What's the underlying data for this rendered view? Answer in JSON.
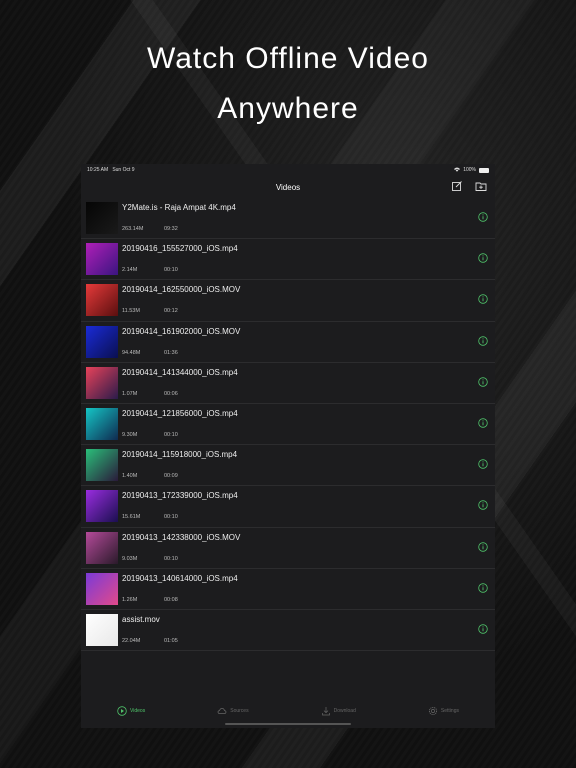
{
  "headline": {
    "line1": "Watch Offline Video",
    "line2": "Anywhere"
  },
  "status": {
    "time": "10:25 AM",
    "date": "Sun Oct 9",
    "battery": "100%"
  },
  "nav": {
    "title": "Videos",
    "edit_icon": "edit-icon",
    "add_icon": "add-folder-icon"
  },
  "videos": [
    {
      "name": "Y2Mate.is - Raja Ampat 4K.mp4",
      "size": "263.14M",
      "duration": "09:32",
      "thumb": [
        "#050505",
        "#1a1a1a"
      ]
    },
    {
      "name": "20190416_155527000_iOS.mp4",
      "size": "2.14M",
      "duration": "00:10",
      "thumb": [
        "#b01fb8",
        "#3a1580"
      ]
    },
    {
      "name": "20190414_162550000_iOS.MOV",
      "size": "11.53M",
      "duration": "00:12",
      "thumb": [
        "#e63a3a",
        "#5a0f0f"
      ]
    },
    {
      "name": "20190414_161902000_iOS.MOV",
      "size": "94.48M",
      "duration": "01:36",
      "thumb": [
        "#1a2bd8",
        "#0a0f50"
      ]
    },
    {
      "name": "20190414_141344000_iOS.mp4",
      "size": "1.07M",
      "duration": "00:06",
      "thumb": [
        "#e8425a",
        "#2a1b4a"
      ]
    },
    {
      "name": "20190414_121856000_iOS.mp4",
      "size": "9.30M",
      "duration": "00:10",
      "thumb": [
        "#15c6c6",
        "#0f2a50"
      ]
    },
    {
      "name": "20190414_115918000_iOS.mp4",
      "size": "1.40M",
      "duration": "00:09",
      "thumb": [
        "#2abf7a",
        "#2a1a3a"
      ]
    },
    {
      "name": "20190413_172339000_iOS.mp4",
      "size": "15.61M",
      "duration": "00:10",
      "thumb": [
        "#9a2de0",
        "#1a0f50"
      ]
    },
    {
      "name": "20190413_142338000_iOS.MOV",
      "size": "9.03M",
      "duration": "00:10",
      "thumb": [
        "#b54a9a",
        "#2a1a2a"
      ]
    },
    {
      "name": "20190413_140614000_iOS.mp4",
      "size": "1.26M",
      "duration": "00:08",
      "thumb": [
        "#7a3ad8",
        "#e24a8a"
      ]
    },
    {
      "name": "assist.mov",
      "size": "22.04M",
      "duration": "01:05",
      "thumb": [
        "#ffffff",
        "#e8e8e8"
      ]
    }
  ],
  "tabs": [
    {
      "label": "Videos",
      "icon": "play-icon",
      "active": true
    },
    {
      "label": "Sources",
      "icon": "cloud-icon",
      "active": false
    },
    {
      "label": "Download",
      "icon": "download-icon",
      "active": false
    },
    {
      "label": "Settings",
      "icon": "gear-icon",
      "active": false
    }
  ],
  "colors": {
    "accent": "#4fc36a",
    "panel": "#1c1c1e",
    "divider": "#2c2c2e"
  }
}
